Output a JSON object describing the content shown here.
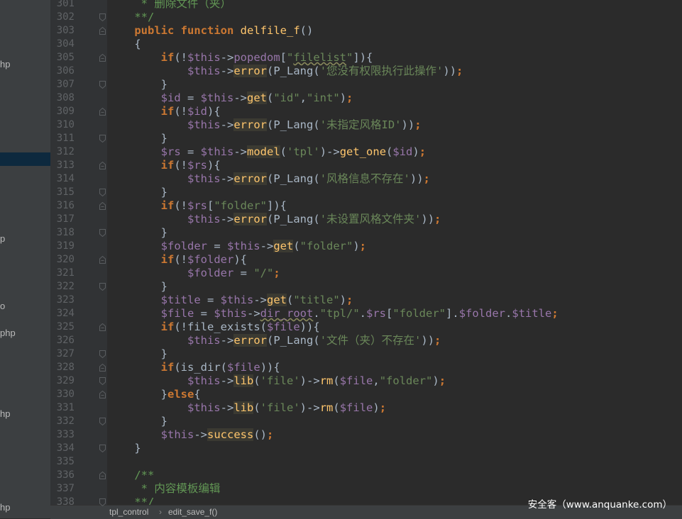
{
  "sidebar": {
    "items": [
      {
        "label": "hp"
      },
      {
        "label": "p"
      },
      {
        "label": "o"
      },
      {
        "label": "php"
      },
      {
        "label": "hp"
      },
      {
        "label": "hp"
      }
    ]
  },
  "editor": {
    "line_numbers": [
      "301",
      "302",
      "303",
      "304",
      "305",
      "306",
      "307",
      "308",
      "309",
      "310",
      "311",
      "312",
      "313",
      "314",
      "315",
      "316",
      "317",
      "318",
      "319",
      "320",
      "321",
      "322",
      "323",
      "324",
      "325",
      "326",
      "327",
      "328",
      "329",
      "330",
      "331",
      "332",
      "333",
      "334",
      "335",
      "336",
      "337",
      "338"
    ],
    "lines": [
      "     * 删除文件（夹）",
      "    **/",
      "    public function delfile_f()",
      "    {",
      "        if(!$this->popedom[\"filelist\"]){",
      "            $this->error(P_Lang('您没有权限执行此操作'));",
      "        }",
      "        $id = $this->get(\"id\",\"int\");",
      "        if(!$id){",
      "            $this->error(P_Lang('未指定风格ID'));",
      "        }",
      "        $rs = $this->model('tpl')->get_one($id);",
      "        if(!$rs){",
      "            $this->error(P_Lang('风格信息不存在'));",
      "        }",
      "        if(!$rs[\"folder\"]){",
      "            $this->error(P_Lang('未设置风格文件夹'));",
      "        }",
      "        $folder = $this->get(\"folder\");",
      "        if(!$folder){",
      "            $folder = \"/\";",
      "        }",
      "        $title = $this->get(\"title\");",
      "        $file = $this->dir_root.\"tpl/\".$rs[\"folder\"].$folder.$title;",
      "        if(!file_exists($file)){",
      "            $this->error(P_Lang('文件（夹）不存在'));",
      "        }",
      "        if(is_dir($file)){",
      "            $this->lib('file')->rm($file,\"folder\");",
      "        }else{",
      "            $this->lib('file')->rm($file);",
      "        }",
      "        $this->success();",
      "    }",
      "",
      "    /**",
      "     * 内容模板编辑",
      "    **/"
    ]
  },
  "statusbar": {
    "breadcrumb": [
      "tpl_control",
      "edit_save_f()"
    ],
    "separator": "›"
  },
  "watermark": "安全客（www.anquanke.com）",
  "colors": {
    "background": "#2b2b2b",
    "keyword": "#cc7832",
    "function": "#ffc66d",
    "variable": "#9876aa",
    "string": "#6a8759",
    "comment": "#629755",
    "plain": "#a9b7c6"
  }
}
